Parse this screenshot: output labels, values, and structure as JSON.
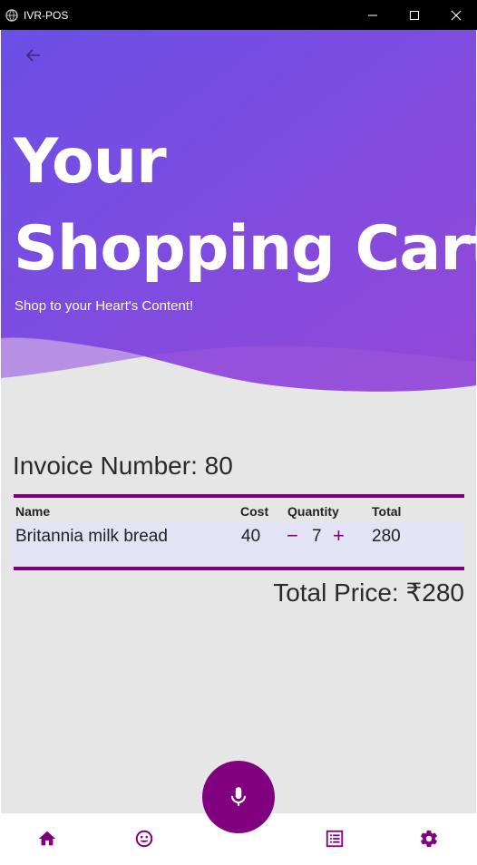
{
  "window": {
    "title": "IVR-POS"
  },
  "hero": {
    "title_line1": "Your",
    "title_line2": "Shopping Cart",
    "subtitle": "Shop to your Heart's Content!",
    "gradient_start": "#6a4fe6",
    "gradient_end": "#9b4bd8"
  },
  "invoice": {
    "label": "Invoice Number: 80"
  },
  "table": {
    "headers": {
      "name": "Name",
      "cost": "Cost",
      "quantity": "Quantity",
      "total": "Total"
    },
    "rows": [
      {
        "name": "Britannia milk bread",
        "cost": "40",
        "quantity": "7",
        "total": "280",
        "minus": "−",
        "plus": "+"
      }
    ]
  },
  "total_price": "Total Price: ₹280",
  "nav": {
    "items": [
      "home-icon",
      "smiley-icon",
      "list-icon",
      "gear-icon"
    ],
    "fab": "microphone-icon"
  },
  "colors": {
    "accent": "#800080",
    "row_bg": "#e3e3f6",
    "page_bg": "#e6e6e6"
  }
}
